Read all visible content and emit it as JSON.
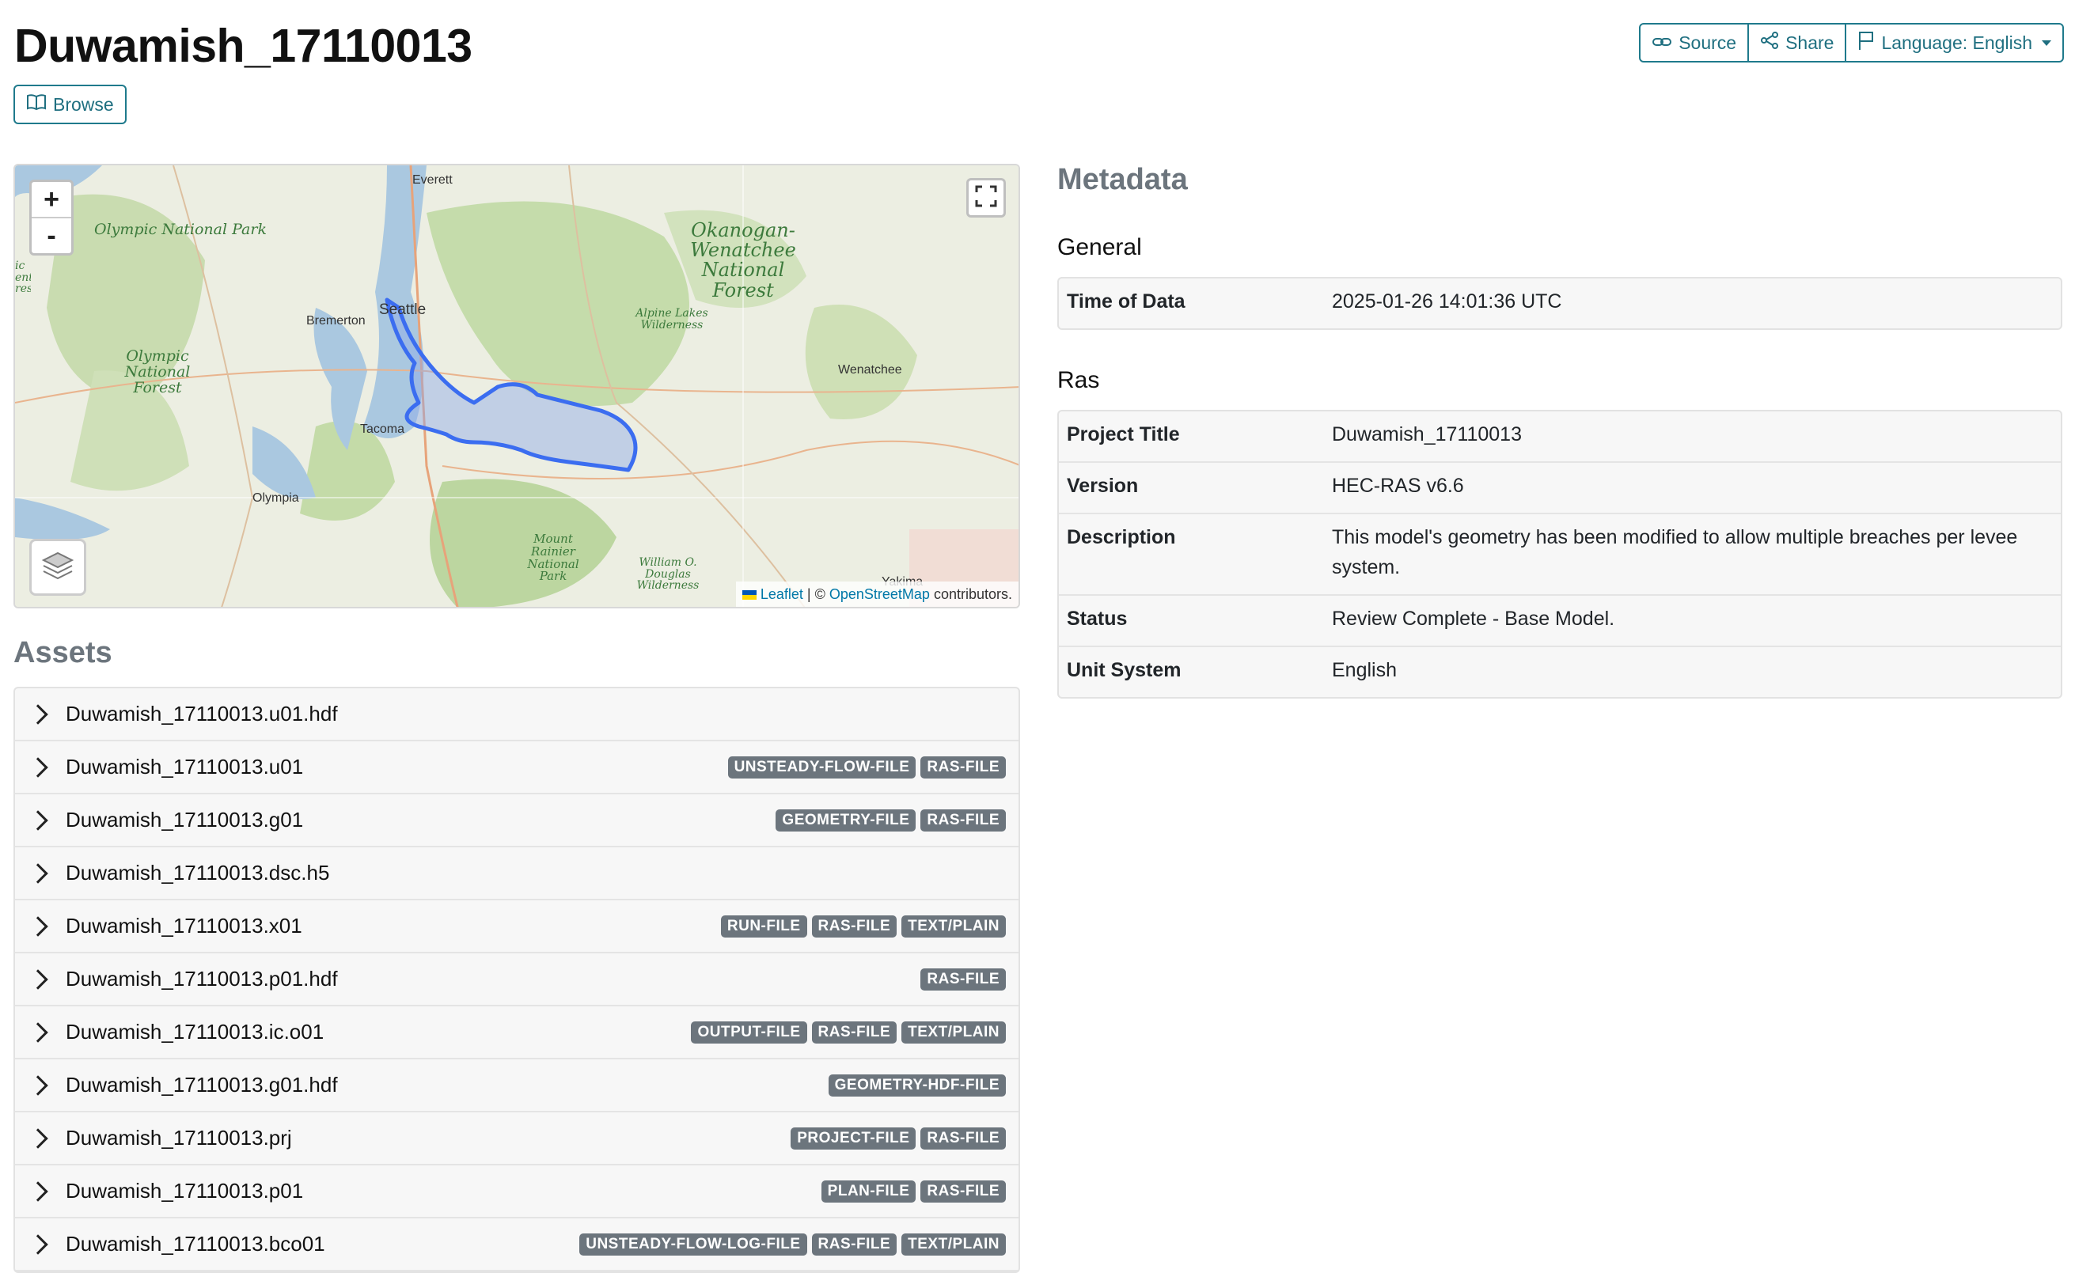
{
  "header": {
    "title": "Duwamish_17110013",
    "browse_label": "Browse",
    "source_label": "Source",
    "share_label": "Share",
    "language_label": "Language: English"
  },
  "map": {
    "zoom_in": "+",
    "zoom_out": "-",
    "labels": {
      "olympic_np": "Olympic National Park",
      "olympic_nf": "Olympic National Forest",
      "okanogan": "Okanogan-Wenatchee National Forest",
      "alpine_lakes": "Alpine Lakes Wilderness",
      "mount_rainier": "Mount Rainier National Park",
      "william_douglas": "William O. Douglas Wilderness",
      "edge_fragment": "ic ental rest"
    },
    "cities": {
      "everett": "Everett",
      "seattle": "Seattle",
      "bremerton": "Bremerton",
      "tacoma": "Tacoma",
      "olympia": "Olympia",
      "wenatchee": "Wenatchee",
      "yakima": "Yakima"
    },
    "attribution": {
      "leaflet": "Leaflet",
      "separator": "| ©",
      "osm": "OpenStreetMap",
      "suffix": "contributors."
    }
  },
  "assets": {
    "heading": "Assets",
    "items": [
      {
        "name": "Duwamish_17110013.u01.hdf",
        "badges": []
      },
      {
        "name": "Duwamish_17110013.u01",
        "badges": [
          "UNSTEADY-FLOW-FILE",
          "RAS-FILE"
        ]
      },
      {
        "name": "Duwamish_17110013.g01",
        "badges": [
          "GEOMETRY-FILE",
          "RAS-FILE"
        ]
      },
      {
        "name": "Duwamish_17110013.dsc.h5",
        "badges": []
      },
      {
        "name": "Duwamish_17110013.x01",
        "badges": [
          "RUN-FILE",
          "RAS-FILE",
          "TEXT/PLAIN"
        ]
      },
      {
        "name": "Duwamish_17110013.p01.hdf",
        "badges": [
          "RAS-FILE"
        ]
      },
      {
        "name": "Duwamish_17110013.ic.o01",
        "badges": [
          "OUTPUT-FILE",
          "RAS-FILE",
          "TEXT/PLAIN"
        ]
      },
      {
        "name": "Duwamish_17110013.g01.hdf",
        "badges": [
          "GEOMETRY-HDF-FILE"
        ]
      },
      {
        "name": "Duwamish_17110013.prj",
        "badges": [
          "PROJECT-FILE",
          "RAS-FILE"
        ]
      },
      {
        "name": "Duwamish_17110013.p01",
        "badges": [
          "PLAN-FILE",
          "RAS-FILE"
        ]
      },
      {
        "name": "Duwamish_17110013.bco01",
        "badges": [
          "UNSTEADY-FLOW-LOG-FILE",
          "RAS-FILE",
          "TEXT/PLAIN"
        ]
      }
    ]
  },
  "metadata": {
    "heading": "Metadata",
    "general": {
      "heading": "General",
      "rows": [
        {
          "key": "Time of Data",
          "value": "2025-01-26 14:01:36 UTC"
        }
      ]
    },
    "ras": {
      "heading": "Ras",
      "rows": [
        {
          "key": "Project Title",
          "value": "Duwamish_17110013"
        },
        {
          "key": "Version",
          "value": "HEC-RAS v6.6"
        },
        {
          "key": "Description",
          "value": "This model's geometry has been modified to allow multiple breaches per levee system."
        },
        {
          "key": "Status",
          "value": "Review Complete - Base Model."
        },
        {
          "key": "Unit System",
          "value": "English"
        }
      ]
    }
  },
  "colors": {
    "accent": "#1f6f80",
    "badge": "#6c757d",
    "watershed_stroke": "#3b6df0",
    "watershed_fill": "#8fa8e8"
  }
}
